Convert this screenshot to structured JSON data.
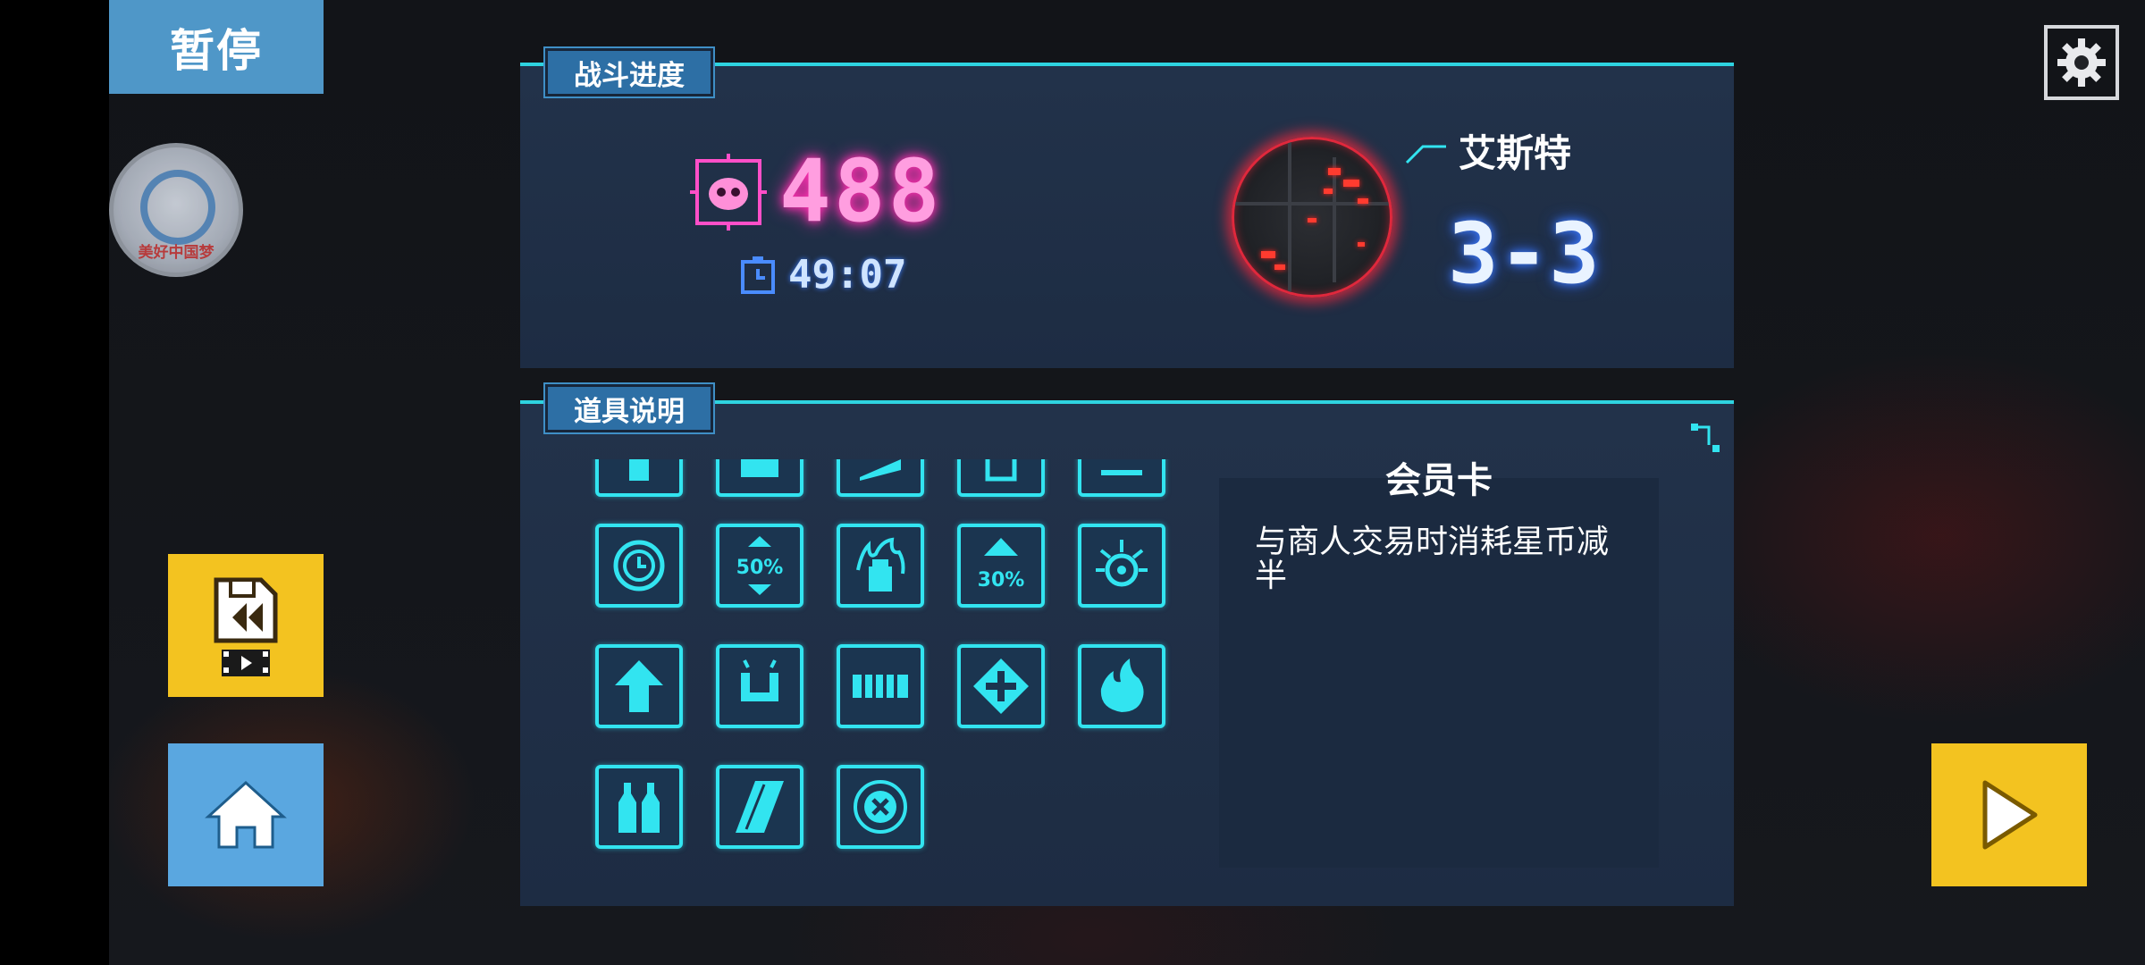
{
  "pause": {
    "title": "暂停"
  },
  "badge": {
    "text": "美好中国梦"
  },
  "battle": {
    "tab_label": "战斗进度",
    "kill_count": "488",
    "time": "49:07",
    "boss_name": "艾斯特",
    "stage": "3-3"
  },
  "items": {
    "tab_label": "道具说明",
    "grid": [
      {
        "name": "item-partial-1",
        "icon": "arrow-up-icon"
      },
      {
        "name": "item-partial-2",
        "icon": "block-icon"
      },
      {
        "name": "item-partial-3",
        "icon": "slash-icon"
      },
      {
        "name": "item-partial-4",
        "icon": "box-icon"
      },
      {
        "name": "item-partial-5",
        "icon": "bar-icon"
      },
      {
        "name": "item-clock",
        "icon": "clock-target-icon"
      },
      {
        "name": "item-50-percent",
        "icon": "resize-50-icon",
        "label": "50%"
      },
      {
        "name": "item-flame-bottle",
        "icon": "flame-bottle-icon"
      },
      {
        "name": "item-30-percent",
        "icon": "up-30-icon",
        "label": "30%"
      },
      {
        "name": "item-crosshair",
        "icon": "crosshair-icon"
      },
      {
        "name": "item-arrow-up",
        "icon": "arrow-up-icon"
      },
      {
        "name": "item-magnet",
        "icon": "magnet-icon"
      },
      {
        "name": "item-fence",
        "icon": "fence-icon"
      },
      {
        "name": "item-dpad",
        "icon": "dpad-icon"
      },
      {
        "name": "item-fire",
        "icon": "fire-icon"
      },
      {
        "name": "item-bottles",
        "icon": "bottles-icon"
      },
      {
        "name": "item-card",
        "icon": "card-icon"
      },
      {
        "name": "item-cancel",
        "icon": "cancel-icon"
      }
    ],
    "detail": {
      "title": "会员卡",
      "description": "与商人交易时消耗星币减半"
    }
  },
  "colors": {
    "accent_cyan": "#32e4f0",
    "kill_pink": "#ff9ee0",
    "button_yellow": "#f3c320",
    "button_blue": "#5aa7e0",
    "tab_blue": "#2d6fa5"
  }
}
